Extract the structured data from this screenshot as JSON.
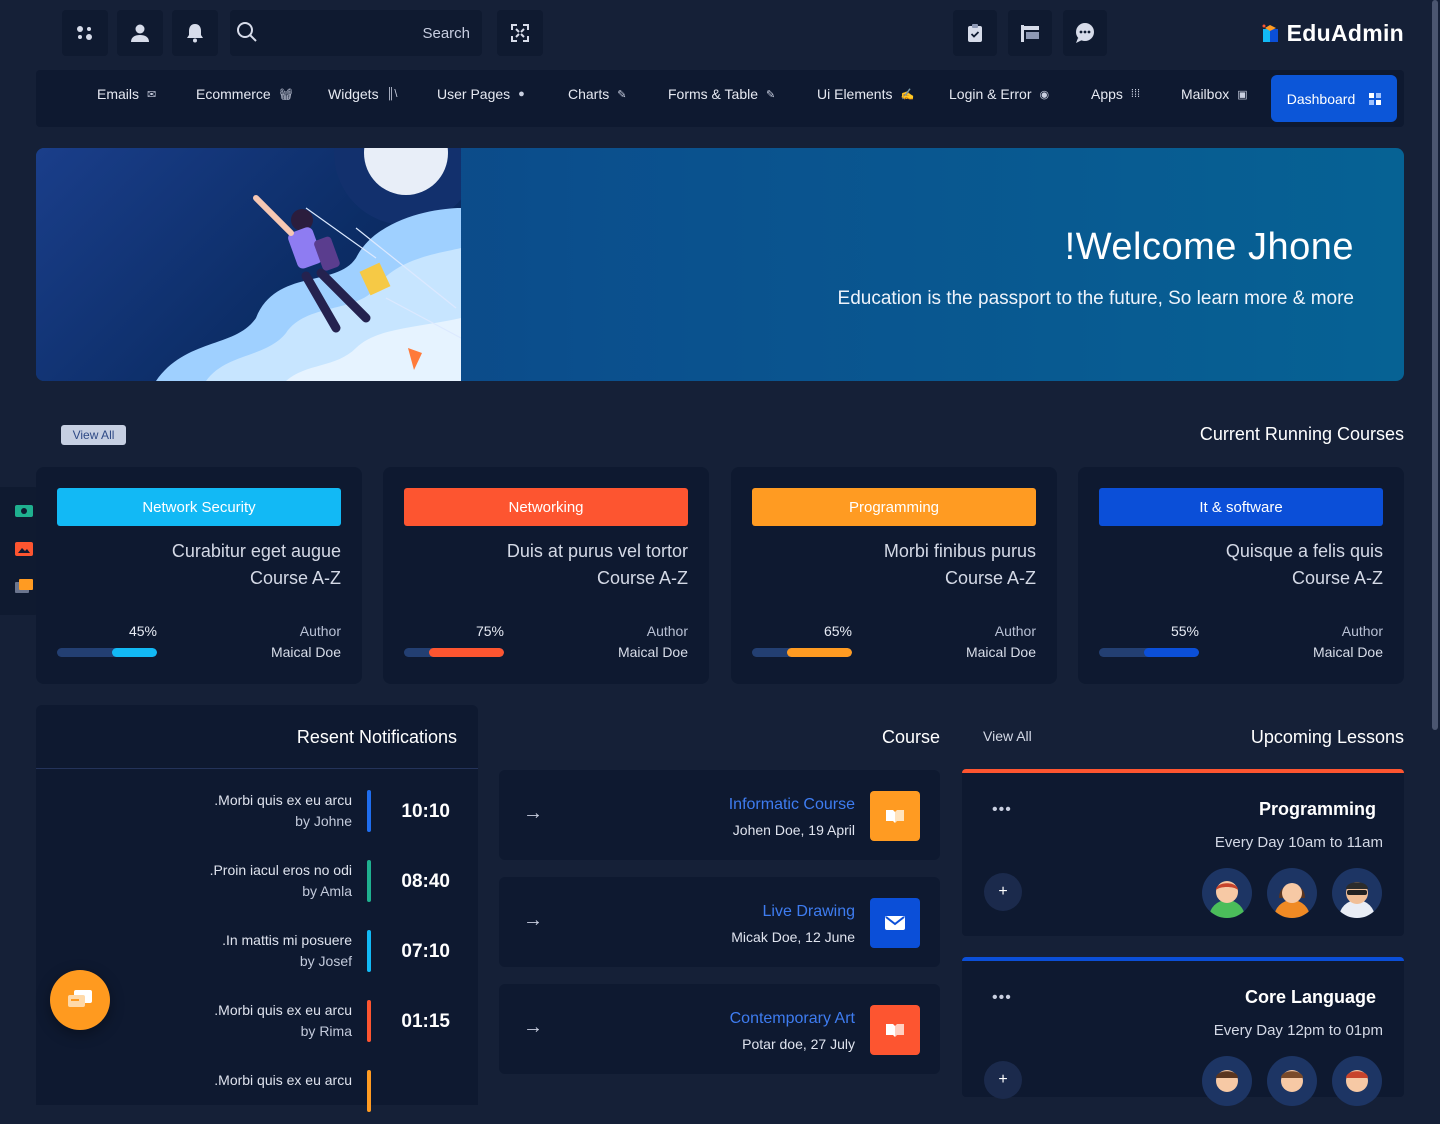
{
  "topbar": {
    "search_label": "Search",
    "logo_text": "EduAdmin"
  },
  "menu": {
    "items": [
      {
        "label": "Emails",
        "icon": "envelope-icon"
      },
      {
        "label": "Ecommerce",
        "icon": "basket-icon"
      },
      {
        "label": "Widgets",
        "icon": "widgets-icon"
      },
      {
        "label": "User Pages",
        "icon": "user-icon"
      },
      {
        "label": "Charts",
        "icon": "pin-icon"
      },
      {
        "label": "Forms & Table",
        "icon": "pin-icon"
      },
      {
        "label": "Ui Elements",
        "icon": "edit-icon"
      },
      {
        "label": "Login & Error",
        "icon": "record-icon"
      },
      {
        "label": "Apps",
        "icon": "grid-icon"
      },
      {
        "label": "Mailbox",
        "icon": "inbox-icon"
      }
    ],
    "active": {
      "label": "Dashboard",
      "icon": "dashboard-icon"
    }
  },
  "hero": {
    "title": "!Welcome Jhone",
    "subtitle": "Education is the passport to the future, So learn more & more"
  },
  "courses_section": {
    "view_all": "View All",
    "title": "Current Running Courses",
    "cards": [
      {
        "tag": "Network Security",
        "color": "#12b9f5",
        "line1": "Curabitur eget augue",
        "line2": "Course A-Z",
        "percent": "45%",
        "progress": 0.45,
        "author_label": "Author",
        "author": "Maical Doe"
      },
      {
        "tag": "Networking",
        "color": "#fd5530",
        "line1": "Duis at purus vel tortor",
        "line2": "Course A-Z",
        "percent": "75%",
        "progress": 0.75,
        "author_label": "Author",
        "author": "Maical Doe"
      },
      {
        "tag": "Programming",
        "color": "#ff9b22",
        "line1": "Morbi finibus purus",
        "line2": "Course A-Z",
        "percent": "65%",
        "progress": 0.65,
        "author_label": "Author",
        "author": "Maical Doe"
      },
      {
        "tag": "It & software",
        "color": "#0b4fd8",
        "line1": "Quisque a felis quis",
        "line2": "Course A-Z",
        "percent": "55%",
        "progress": 0.55,
        "author_label": "Author",
        "author": "Maical Doe"
      }
    ]
  },
  "notifications": {
    "title": "Resent Notifications",
    "items": [
      {
        "message": ".Morbi quis ex eu arcu",
        "by": "by Johne",
        "time": "10:10",
        "color": "#1f6dee"
      },
      {
        "message": ".Proin iacul eros no odi",
        "by": "by Amla",
        "time": "08:40",
        "color": "#1fb08f"
      },
      {
        "message": ".In mattis mi posuere",
        "by": "by Josef",
        "time": "07:10",
        "color": "#12b9f5"
      },
      {
        "message": ".Morbi quis ex eu arcu",
        "by": "by Rima",
        "time": "01:15",
        "color": "#fd5530"
      },
      {
        "message": ".Morbi quis ex eu arcu",
        "by": "",
        "time": "",
        "color": "#ff9b22"
      }
    ]
  },
  "course_list": {
    "title": "Course",
    "items": [
      {
        "name": "Informatic Course",
        "meta": "Johen Doe, 19 April",
        "icon": "book-icon",
        "color": "#ff9b22"
      },
      {
        "name": "Live Drawing",
        "meta": "Micak Doe, 12 June",
        "icon": "mail-icon",
        "color": "#0b4fd8"
      },
      {
        "name": "Contemporary Art",
        "meta": "Potar doe, 27 July",
        "icon": "book-icon",
        "color": "#fd5530"
      }
    ]
  },
  "lessons": {
    "view_all": "View All",
    "title": "Upcoming Lessons",
    "items": [
      {
        "title": "Programming",
        "schedule": "Every Day 10am to 11am",
        "accent": "#fd5530"
      },
      {
        "title": "Core Language",
        "schedule": "Every Day 12pm to 01pm",
        "accent": "#0b4fd8"
      }
    ]
  }
}
